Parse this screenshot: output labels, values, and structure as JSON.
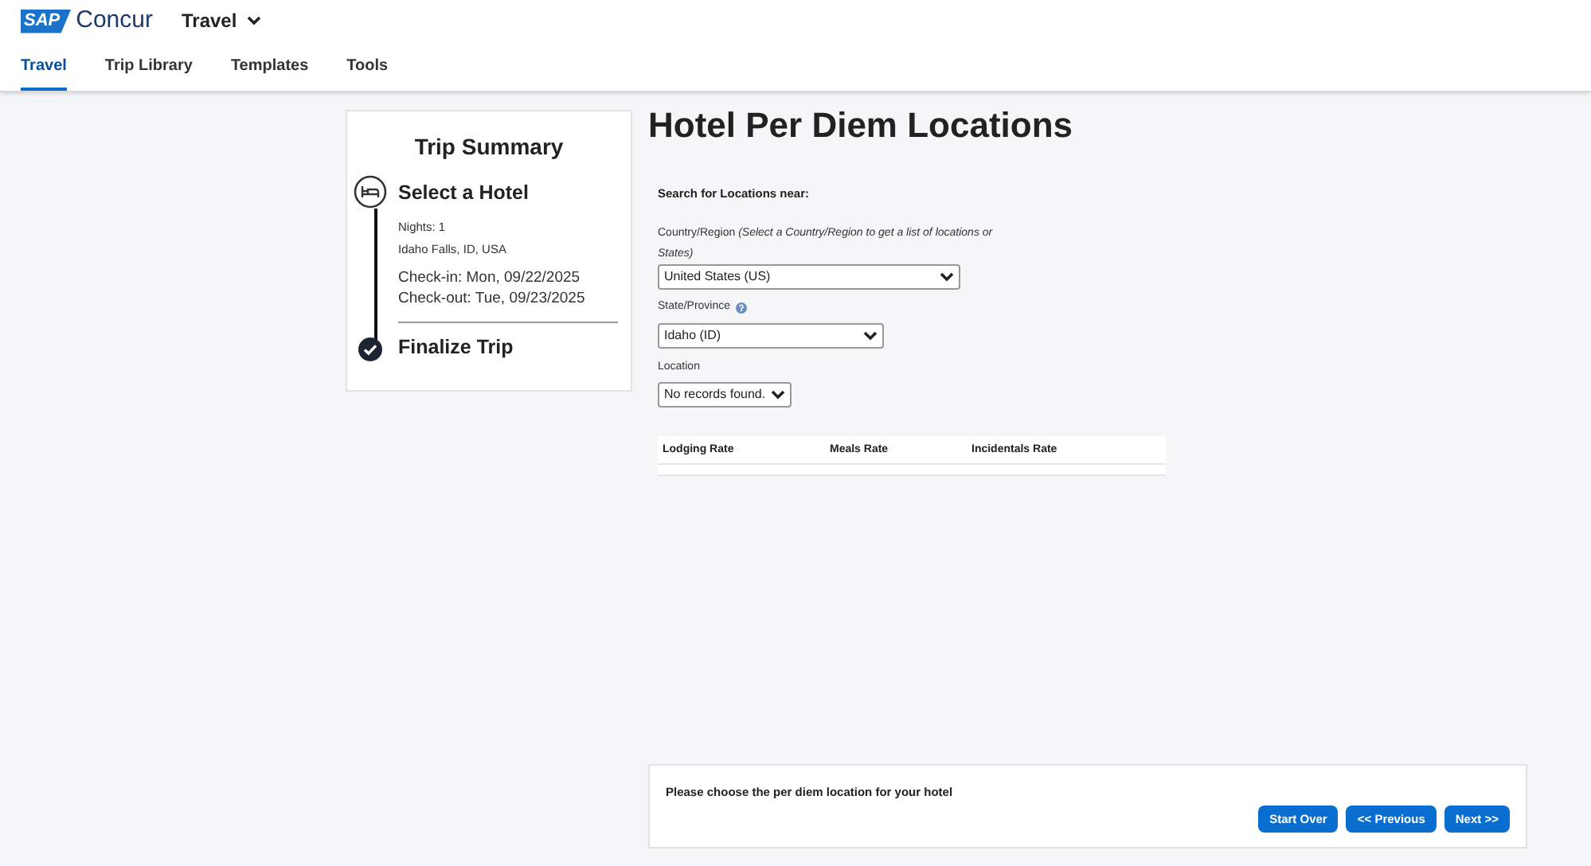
{
  "header": {
    "logo_badge": "SAP",
    "logo_text": "Concur",
    "app_menu": "Travel"
  },
  "tabs": [
    {
      "label": "Travel",
      "selected": true
    },
    {
      "label": "Trip Library",
      "selected": false
    },
    {
      "label": "Templates",
      "selected": false
    },
    {
      "label": "Tools",
      "selected": false
    }
  ],
  "trip_summary": {
    "title": "Trip Summary",
    "steps": [
      {
        "kind": "hotel",
        "title": "Select a Hotel",
        "details": [
          "Nights: 1",
          "Idaho Falls, ID, USA"
        ],
        "dates": [
          "Check-in: Mon, 09/22/2025",
          "Check-out: Tue, 09/23/2025"
        ]
      },
      {
        "kind": "done",
        "title": "Finalize Trip"
      }
    ]
  },
  "page_title": "Hotel Per Diem Locations",
  "search": {
    "heading": "Search for Locations near:",
    "country": {
      "label": "Country/Region",
      "hint": "(Select a Country/Region to get a list of locations or",
      "hint_cont": "States)",
      "value": "United States (US)"
    },
    "state": {
      "label": "State/Province",
      "value": "Idaho (ID)"
    },
    "location": {
      "label": "Location",
      "value": "No records found."
    }
  },
  "rates_table": {
    "columns": [
      "Lodging Rate",
      "Meals Rate",
      "Incidentals Rate"
    ]
  },
  "footer": {
    "message": "Please choose the per diem location for your hotel",
    "buttons": [
      "Start Over",
      "<< Previous",
      "Next >>"
    ]
  }
}
